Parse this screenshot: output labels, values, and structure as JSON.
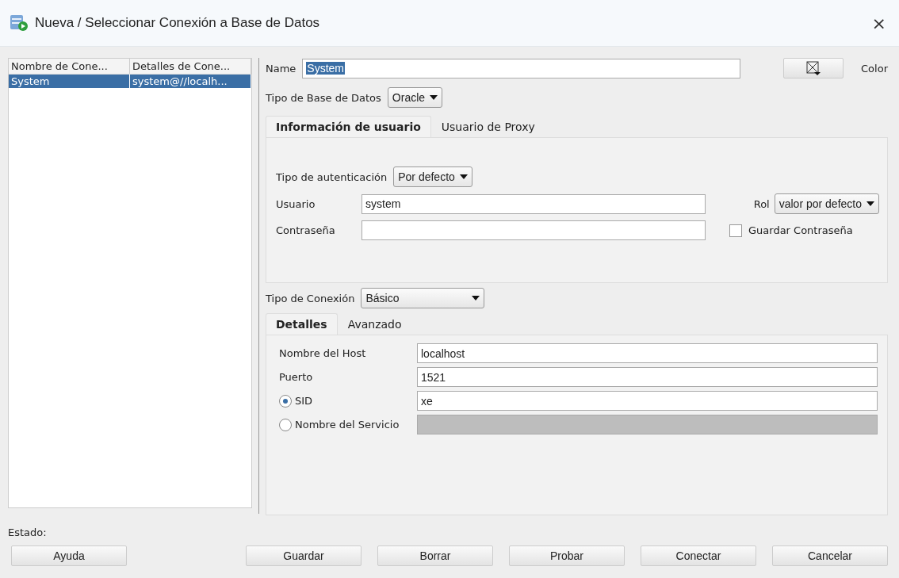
{
  "window": {
    "title": "Nueva / Seleccionar Conexión a Base de Datos",
    "close": "×"
  },
  "connections": {
    "columns": [
      "Nombre de Cone...",
      "Detalles de Cone..."
    ],
    "rows": [
      {
        "cells": [
          "System",
          "system@//localh..."
        ],
        "selected": true
      }
    ]
  },
  "name_field": {
    "label": "Name",
    "value": "System",
    "text_selected": true
  },
  "color_button": {
    "label": "Color"
  },
  "db_type": {
    "label": "Tipo de Base de Datos",
    "value": "Oracle"
  },
  "user_tabs": [
    {
      "label": "Información de usuario",
      "selected": true
    },
    {
      "label": "Usuario de Proxy",
      "selected": false
    }
  ],
  "auth_type": {
    "label": "Tipo de autenticación",
    "value": "Por defecto"
  },
  "user": {
    "label": "Usuario",
    "value": "system"
  },
  "password": {
    "label": "Contraseña"
  },
  "role": {
    "label": "Rol",
    "value": "valor por defecto"
  },
  "save_password": {
    "label": "Guardar Contraseña",
    "checked": false
  },
  "connection_type": {
    "label": "Tipo de Conexión",
    "value": "Básico"
  },
  "detail_tabs": [
    {
      "label": "Detalles",
      "selected": true
    },
    {
      "label": "Avanzado",
      "selected": false
    }
  ],
  "details": [
    {
      "kind": "field",
      "label": "Nombre del Host",
      "value": "localhost"
    },
    {
      "kind": "field",
      "label": "Puerto",
      "value": "1521"
    },
    {
      "kind": "radio",
      "label": "SID",
      "selected": true,
      "disabled": false,
      "value": "xe"
    },
    {
      "kind": "radio",
      "label": "Nombre del Servicio",
      "selected": false,
      "disabled": true
    }
  ],
  "status": {
    "label": "Estado:"
  },
  "help_button": {
    "label": "Ayuda"
  },
  "buttons": [
    {
      "label": "Guardar"
    },
    {
      "label": "Borrar"
    },
    {
      "label": "Probar"
    },
    {
      "label": "Conectar"
    },
    {
      "label": "Cancelar"
    }
  ]
}
